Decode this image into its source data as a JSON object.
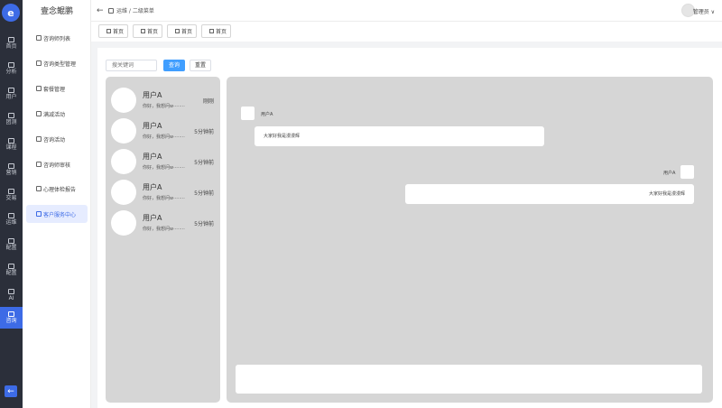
{
  "app": {
    "brand": "壹念鲲鹏",
    "logo_glyph": "e"
  },
  "rail": [
    {
      "label": "首页",
      "active": false
    },
    {
      "label": "分析",
      "active": false
    },
    {
      "label": "用户",
      "active": false
    },
    {
      "label": "团测",
      "active": false
    },
    {
      "label": "课程",
      "active": false
    },
    {
      "label": "营销",
      "active": false
    },
    {
      "label": "交易",
      "active": false
    },
    {
      "label": "运维",
      "active": false
    },
    {
      "label": "配置",
      "active": false
    },
    {
      "label": "配置",
      "active": false
    },
    {
      "label": "AI",
      "active": false
    },
    {
      "label": "咨询",
      "active": true
    }
  ],
  "rail_back_icon": "←",
  "submenu": [
    {
      "label": "咨询师列表",
      "active": false
    },
    {
      "label": "咨询类型管理",
      "active": false
    },
    {
      "label": "套餐管理",
      "active": false
    },
    {
      "label": "满减活动",
      "active": false
    },
    {
      "label": "咨询活动",
      "active": false
    },
    {
      "label": "咨询师审核",
      "active": false
    },
    {
      "label": "心理体检报告",
      "active": false
    },
    {
      "label": "客户服务中心",
      "active": true
    }
  ],
  "header": {
    "back_icon": "←",
    "breadcrumb": "运维 / 二级菜单",
    "user": "管理员 ∨"
  },
  "tabs": [
    "首页",
    "首页",
    "首页",
    "首页"
  ],
  "search": {
    "placeholder": "搜关键词",
    "query_label": "查询",
    "reset_label": "重置"
  },
  "conversations": [
    {
      "name": "用户A",
      "preview": "你好，我想问w········",
      "time": "刚刚"
    },
    {
      "name": "用户A",
      "preview": "你好，我想问w········",
      "time": "5分钟前"
    },
    {
      "name": "用户A",
      "preview": "你好，我想问w········",
      "time": "5分钟前"
    },
    {
      "name": "用户A",
      "preview": "你好，我想问w········",
      "time": "5分钟前"
    },
    {
      "name": "用户A",
      "preview": "你好，我想问w········",
      "time": "5分钟前"
    }
  ],
  "messages": [
    {
      "side": "left",
      "name": "用户A",
      "text": "大家好我是漫漫辉"
    },
    {
      "side": "right",
      "name": "用户A",
      "text": "大家好我是漫漫辉"
    }
  ],
  "colors": {
    "accent": "#3d6be6",
    "primary_button": "#409eff",
    "panel_gray": "#d6d6d6",
    "rail_bg": "#2b2f3a"
  }
}
